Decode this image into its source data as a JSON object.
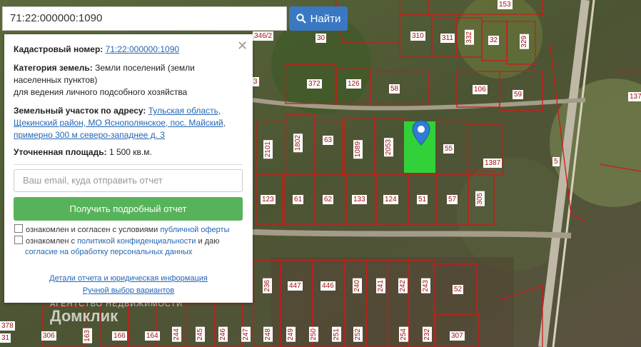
{
  "search": {
    "value": "71:22:000000:1090",
    "button_label": "Найти"
  },
  "panel": {
    "cadastral_label": "Кадастровый номер:",
    "cadastral_value": "71:22:000000:1090",
    "category_label": "Категория земель:",
    "category_value": "Земли поселений (земли населенных пунктов)",
    "category_purpose": "для ведения личного подсобного хозяйства",
    "address_label": "Земельный участок по адресу:",
    "address_value": "Тульская область, Щекинский район, МО Яснополянское, пос. Майский, примерно 300 м северо-западнее д. 3",
    "area_label": "Уточненная площадь:",
    "area_value": "1 500 кв.м.",
    "email_placeholder": "Ваш email, куда отправить отчет",
    "report_button": "Получить подробный отчет",
    "consent1_text": "ознакомлен и согласен с условиями ",
    "consent1_link": "публичной оферты",
    "consent2_text": "ознакомлен с ",
    "consent2_link1": "политикой конфиденциальности",
    "consent2_mid": " и даю ",
    "consent2_link2": "согласие на обработку персональных данных",
    "details_link": "Детали отчета и юридическая информация",
    "manual_link": "Ручной выбор вариантов"
  },
  "watermark": {
    "small": "АГЕНТСТВО НЕДВИЖИМОСТИ",
    "brand": "Домклик"
  },
  "map_labels": [
    "346/2",
    "30",
    "310",
    "311",
    "332",
    "32",
    "329",
    "153",
    "3",
    "372",
    "126",
    "58",
    "106",
    "59",
    "137",
    "2101",
    "1802",
    "63",
    "1089",
    "2053",
    "55",
    "1387",
    "5",
    "123",
    "61",
    "62",
    "133",
    "124",
    "51",
    "57",
    "305",
    "236",
    "447",
    "446",
    "240",
    "241",
    "242",
    "243",
    "52",
    "378",
    "306",
    "163",
    "166",
    "164",
    "244",
    "245",
    "246",
    "247",
    "248",
    "249",
    "250",
    "251",
    "252",
    "254",
    "232",
    "307",
    "31"
  ],
  "colors": {
    "accent": "#3a78c4",
    "report": "#57b35a",
    "parcel": "#2fd83a",
    "boundary": "#d01818"
  }
}
